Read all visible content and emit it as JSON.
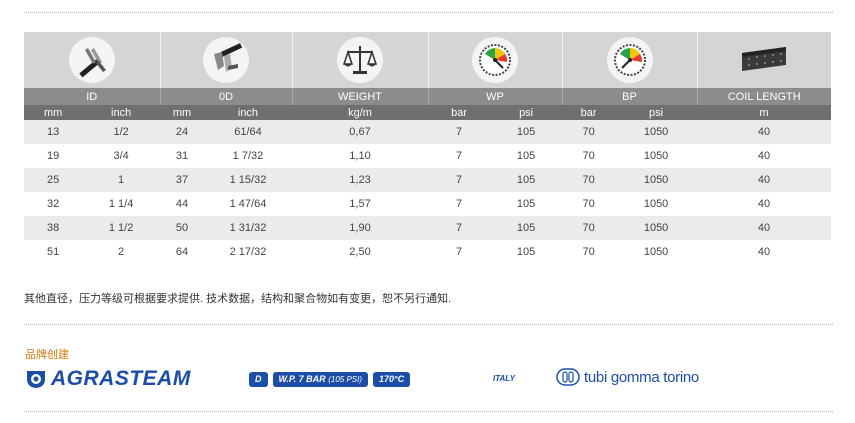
{
  "table": {
    "groups": [
      {
        "name": "ID",
        "icon": "caliper-icon"
      },
      {
        "name": "0D",
        "icon": "caliper-icon"
      },
      {
        "name": "WEIGHT",
        "icon": "scale-icon"
      },
      {
        "name": "WP",
        "icon": "pressure-gauge-icon"
      },
      {
        "name": "BP",
        "icon": "pressure-gauge-icon"
      },
      {
        "name": "COIL LENGTH",
        "icon": "hose-coil-icon"
      }
    ],
    "units": [
      "mm",
      "inch",
      "mm",
      "inch",
      "kg/m",
      "bar",
      "psi",
      "bar",
      "psi",
      "m"
    ],
    "rows": [
      [
        "13",
        "1/2",
        "24",
        "61/64",
        "0,67",
        "7",
        "105",
        "70",
        "1050",
        "40"
      ],
      [
        "19",
        "3/4",
        "31",
        "1 7/32",
        "1,10",
        "7",
        "105",
        "70",
        "1050",
        "40"
      ],
      [
        "25",
        "1",
        "37",
        "1 15/32",
        "1,23",
        "7",
        "105",
        "70",
        "1050",
        "40"
      ],
      [
        "32",
        "1 1/4",
        "44",
        "1 47/64",
        "1,57",
        "7",
        "105",
        "70",
        "1050",
        "40"
      ],
      [
        "38",
        "1 1/2",
        "50",
        "1 31/32",
        "1,90",
        "7",
        "105",
        "70",
        "1050",
        "40"
      ],
      [
        "51",
        "2",
        "64",
        "2 17/32",
        "2,50",
        "7",
        "105",
        "70",
        "1050",
        "40"
      ]
    ]
  },
  "note": "其他直径，压力等级可根据要求提供. 技术数据，结构和聚合物如有变更，恕不另行通知.",
  "brand": {
    "title": "品牌创建",
    "agrasteam": "AGRASTEAM",
    "badges": {
      "d": "D",
      "wp_main": "W.P. 7 BAR",
      "wp_psi": "(105 PSI)",
      "temp": "170°C"
    },
    "italy": "ITALY",
    "tubi": "tubi gomma torino"
  },
  "colors": {
    "brand_blue": "#1c4ea8",
    "brand_orange": "#d4790b",
    "header_dark": "#6f6f6f",
    "header_mid": "#8c8c8c",
    "header_light": "#d5d5d5"
  }
}
